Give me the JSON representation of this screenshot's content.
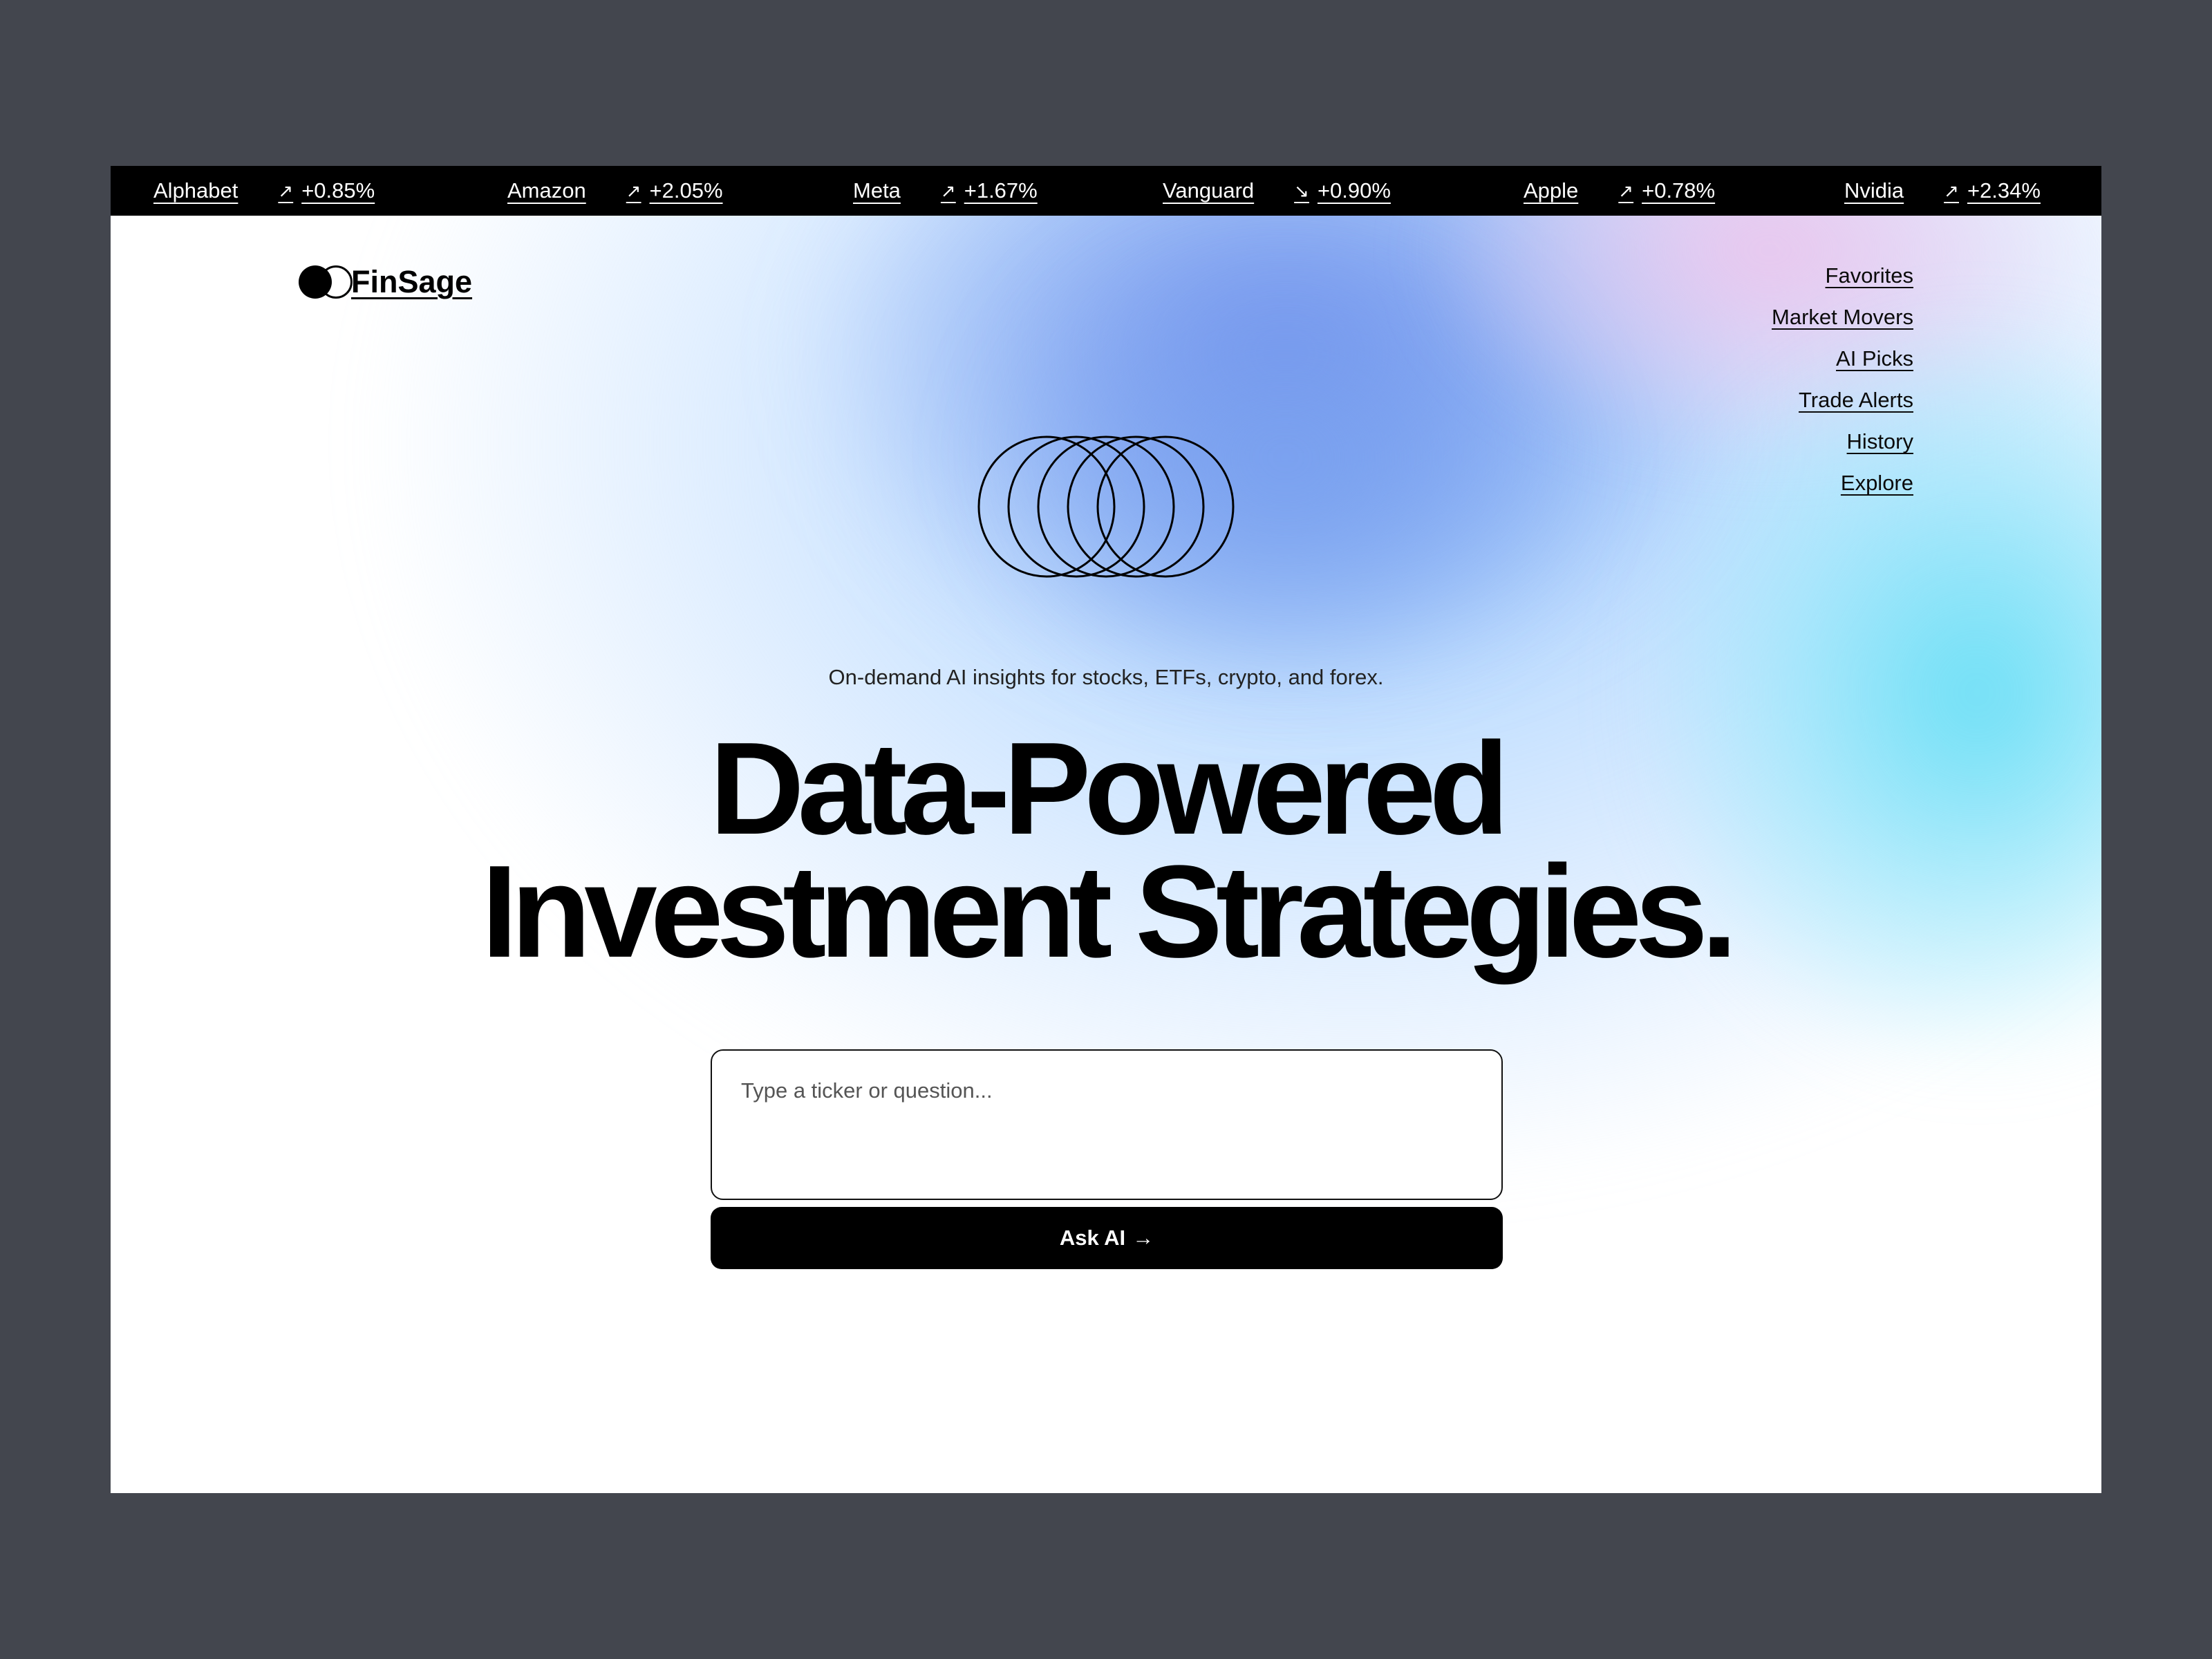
{
  "ticker": [
    {
      "name": "Alphabet",
      "direction": "up",
      "arrow": "↗",
      "change": "+0.85%"
    },
    {
      "name": "Amazon",
      "direction": "up",
      "arrow": "↗",
      "change": "+2.05%"
    },
    {
      "name": "Meta",
      "direction": "up",
      "arrow": "↗",
      "change": "+1.67%"
    },
    {
      "name": "Vanguard",
      "direction": "down",
      "arrow": "↘",
      "change": "+0.90%"
    },
    {
      "name": "Apple",
      "direction": "up",
      "arrow": "↗",
      "change": "+0.78%"
    },
    {
      "name": "Nvidia",
      "direction": "up",
      "arrow": "↗",
      "change": "+2.34%"
    }
  ],
  "brand": {
    "name": "FinSage"
  },
  "nav": {
    "items": [
      "Favorites",
      "Market Movers",
      "AI Picks",
      "Trade Alerts",
      "History",
      "Explore"
    ]
  },
  "hero": {
    "tagline": "On-demand AI insights for stocks, ETFs, crypto, and forex.",
    "headline_line1": "Data-Powered",
    "headline_line2": "Investment Strategies."
  },
  "query": {
    "placeholder": "Type a ticker or question...",
    "value": "",
    "button_label": "Ask AI",
    "button_arrow": "→"
  },
  "colors": {
    "background": "#43464e",
    "ticker_bg": "#000000",
    "gradient_blue": "#6e8ceb",
    "gradient_cyan": "#64def5",
    "gradient_pink": "#ecc3ec",
    "button_bg": "#000000"
  }
}
